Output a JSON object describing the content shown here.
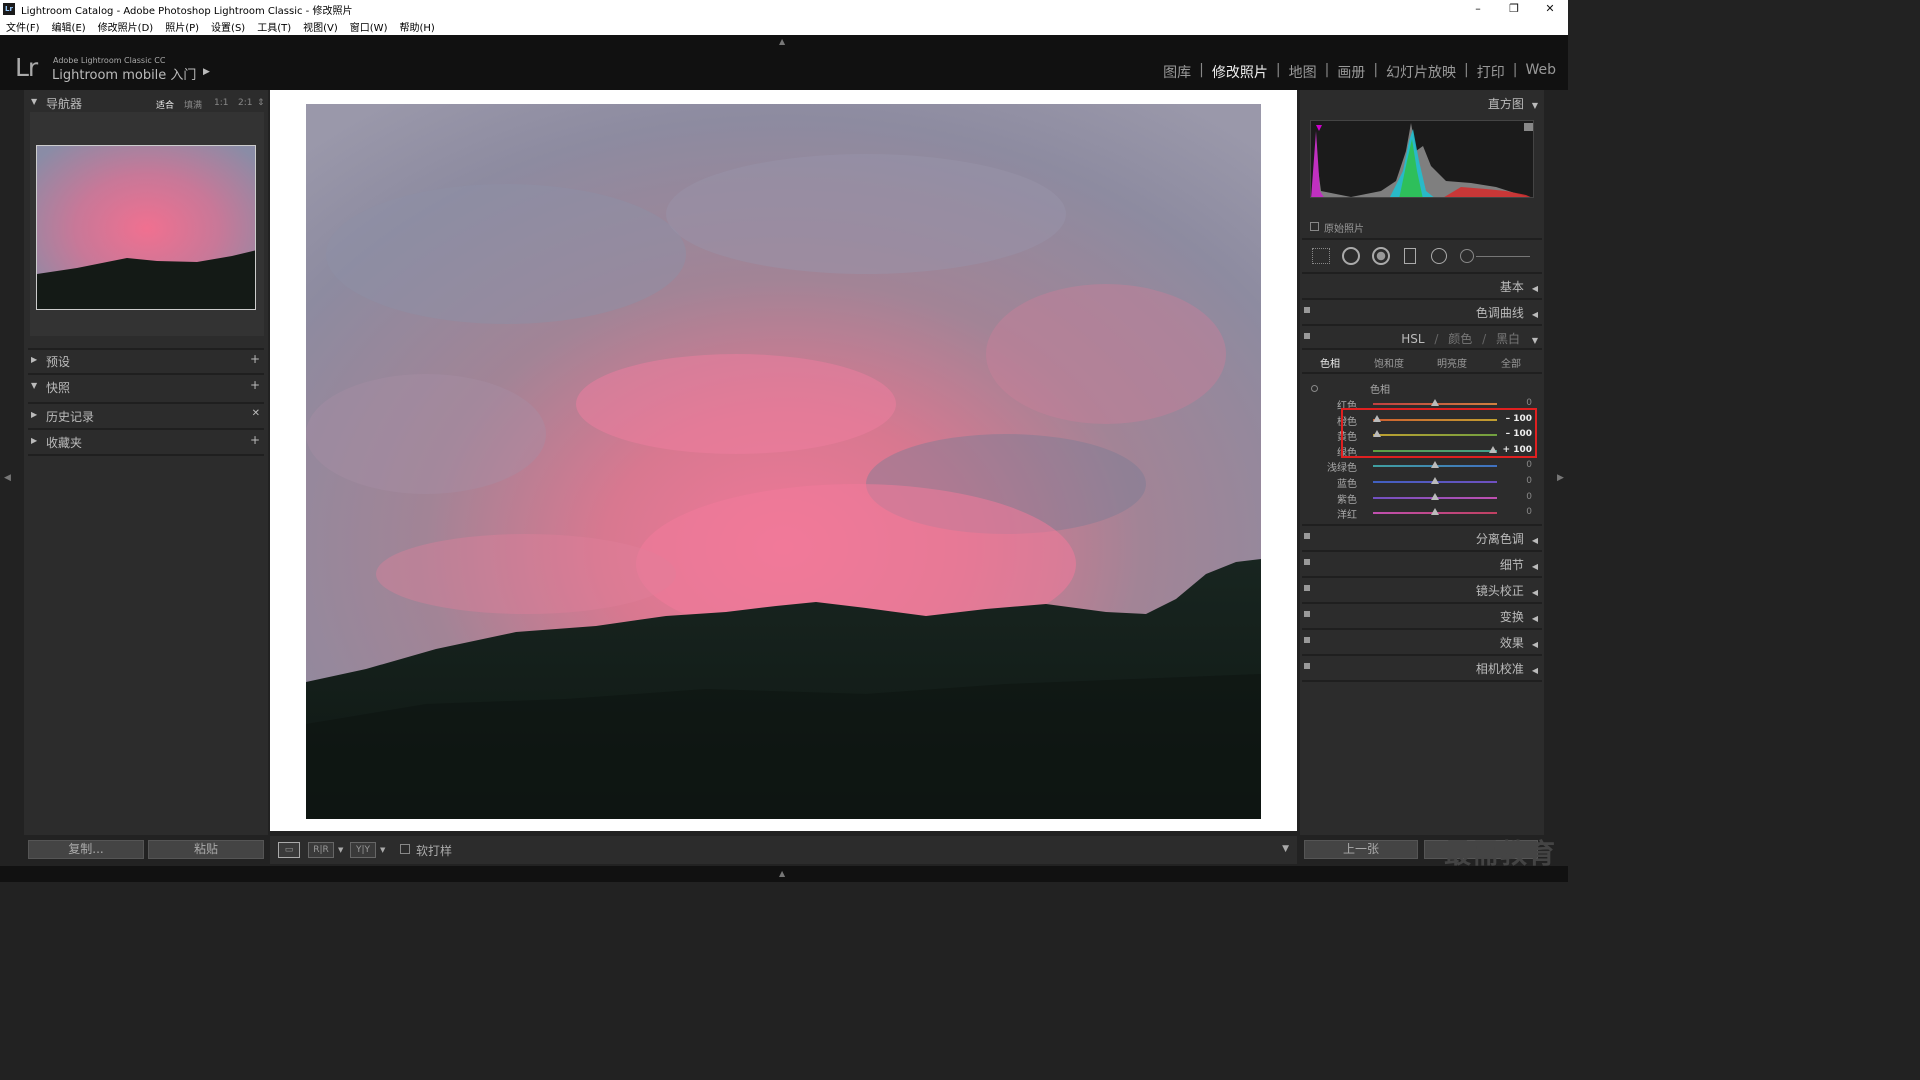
{
  "window": {
    "title": "Lightroom Catalog - Adobe Photoshop Lightroom Classic - 修改照片",
    "app_icon": "Lr",
    "minimize": "–",
    "maximize": "❐",
    "close": "✕"
  },
  "menu": [
    "文件(F)",
    "编辑(E)",
    "修改照片(D)",
    "照片(P)",
    "设置(S)",
    "工具(T)",
    "视图(V)",
    "窗口(W)",
    "帮助(H)"
  ],
  "identity": {
    "logo": "Lr",
    "product": "Adobe Lightroom Classic CC",
    "mobile": "Lightroom mobile 入门",
    "arrow": "▶"
  },
  "modules": [
    {
      "label": "图库",
      "active": false
    },
    {
      "label": "修改照片",
      "active": true
    },
    {
      "label": "地图",
      "active": false
    },
    {
      "label": "画册",
      "active": false
    },
    {
      "label": "幻灯片放映",
      "active": false
    },
    {
      "label": "打印",
      "active": false
    },
    {
      "label": "Web",
      "active": false
    }
  ],
  "left": {
    "navigator": {
      "label": "导航器",
      "zoom": [
        "适合",
        "填满",
        "1:1",
        "2:1"
      ]
    },
    "presets": "预设",
    "snapshots": "快照",
    "history": "历史记录",
    "collections": "收藏夹",
    "copy_btn": "复制...",
    "paste_btn": "粘贴"
  },
  "toolbar": {
    "soft_proof": "软打样",
    "view_rr": "R|R",
    "view_yy": "Y|Y"
  },
  "right": {
    "histogram": "直方图",
    "original_photo": "原始照片",
    "basic": "基本",
    "tone_curve": "色调曲线",
    "hsl": {
      "hsl": "HSL",
      "color": "颜色",
      "bw": "黑白"
    },
    "hsl_tabs": [
      "色相",
      "饱和度",
      "明亮度",
      "全部"
    ],
    "hue_group": "色相",
    "sliders": [
      {
        "label": "红色",
        "value": "0",
        "level": 0
      },
      {
        "label": "橙色",
        "value": "– 100",
        "level": -100
      },
      {
        "label": "黄色",
        "value": "– 100",
        "level": -100
      },
      {
        "label": "绿色",
        "value": "+ 100",
        "level": 100
      },
      {
        "label": "浅绿色",
        "value": "0",
        "level": 0
      },
      {
        "label": "蓝色",
        "value": "0",
        "level": 0
      },
      {
        "label": "紫色",
        "value": "0",
        "level": 0
      },
      {
        "label": "洋红",
        "value": "0",
        "level": 0
      }
    ],
    "sections": [
      "分离色调",
      "细节",
      "镜头校正",
      "变换",
      "效果",
      "相机校准"
    ],
    "prev_btn": "上一张"
  },
  "watermark": "最需教育",
  "colors": {
    "panel_bg": "#2c2c2c",
    "highlight_box": "#e02020"
  }
}
